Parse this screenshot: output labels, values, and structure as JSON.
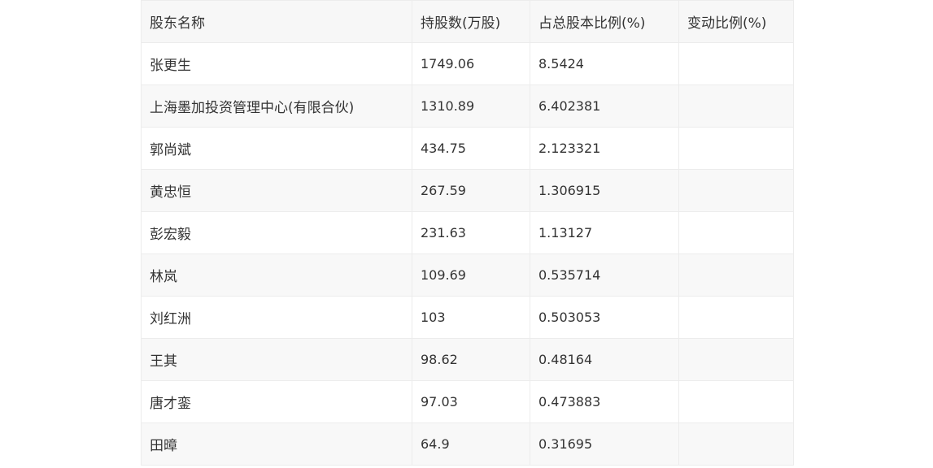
{
  "table": {
    "headers": [
      "股东名称",
      "持股数(万股)",
      "占总股本比例(%)",
      "变动比例(%)"
    ],
    "rows": [
      [
        "张更生",
        "1749.06",
        "8.5424",
        ""
      ],
      [
        "上海墨加投资管理中心(有限合伙)",
        "1310.89",
        "6.402381",
        ""
      ],
      [
        "郭尚斌",
        "434.75",
        "2.123321",
        ""
      ],
      [
        "黄忠恒",
        "267.59",
        "1.306915",
        ""
      ],
      [
        "彭宏毅",
        "231.63",
        "1.13127",
        ""
      ],
      [
        "林岚",
        "109.69",
        "0.535714",
        ""
      ],
      [
        "刘红洲",
        "103",
        "0.503053",
        ""
      ],
      [
        "王其",
        "98.62",
        "0.48164",
        ""
      ],
      [
        "唐才銮",
        "97.03",
        "0.473883",
        ""
      ],
      [
        "田暲",
        "64.9",
        "0.31695",
        ""
      ]
    ]
  }
}
